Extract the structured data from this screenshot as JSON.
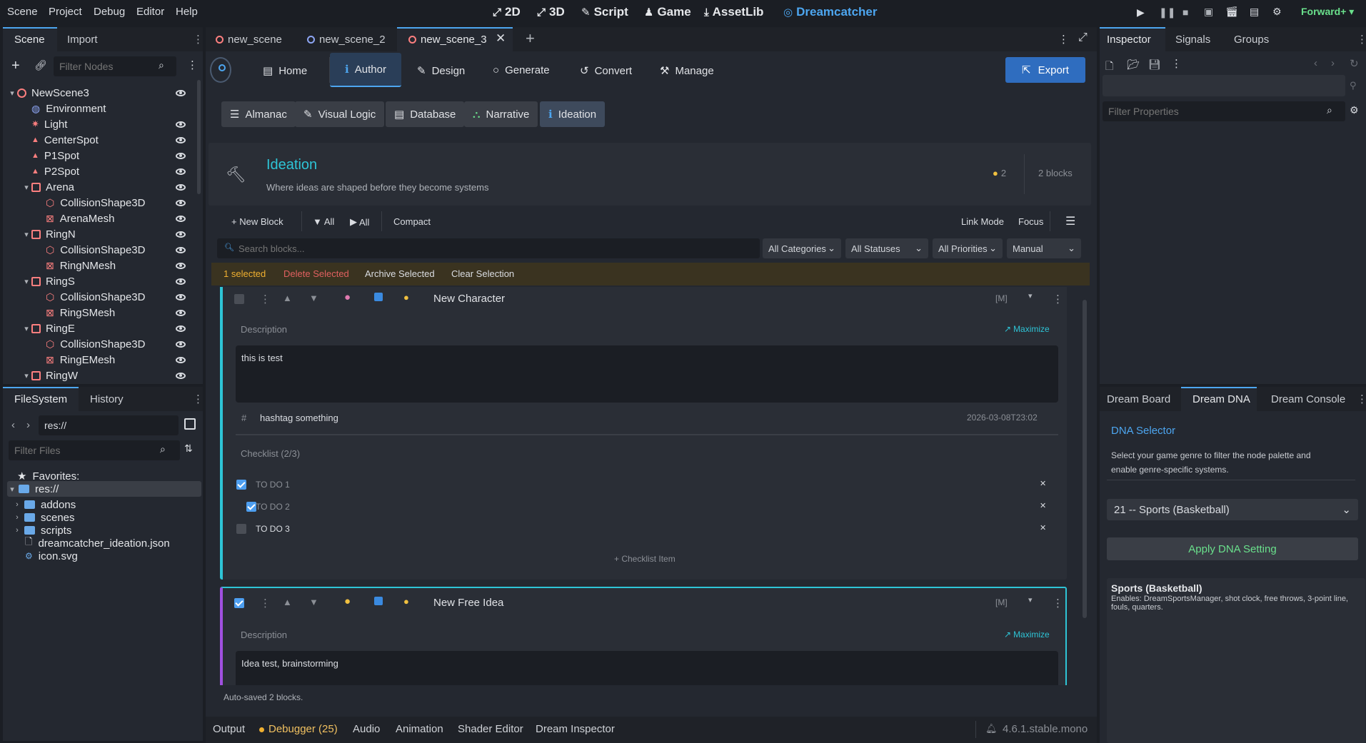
{
  "menubar": {
    "items": [
      "Scene",
      "Project",
      "Debug",
      "Editor",
      "Help"
    ],
    "workspaces": [
      "2D",
      "3D",
      "Script",
      "Game",
      "AssetLib",
      "Dreamcatcher"
    ],
    "renderer": "Forward+"
  },
  "scene_dock": {
    "tabs": [
      "Scene",
      "Import"
    ],
    "filter_placeholder": "Filter Nodes",
    "tree": [
      {
        "name": "NewScene3",
        "depth": 0,
        "icon": "circle",
        "expand": "down"
      },
      {
        "name": "Environment",
        "depth": 1,
        "icon": "env",
        "eye": false
      },
      {
        "name": "Light",
        "depth": 1,
        "icon": "light"
      },
      {
        "name": "CenterSpot",
        "depth": 1,
        "icon": "spot"
      },
      {
        "name": "P1Spot",
        "depth": 1,
        "icon": "spot"
      },
      {
        "name": "P2Spot",
        "depth": 1,
        "icon": "spot"
      },
      {
        "name": "Arena",
        "depth": 1,
        "icon": "node",
        "expand": "down"
      },
      {
        "name": "CollisionShape3D",
        "depth": 2,
        "icon": "col"
      },
      {
        "name": "ArenaMesh",
        "depth": 2,
        "icon": "mesh"
      },
      {
        "name": "RingN",
        "depth": 1,
        "icon": "node",
        "expand": "down"
      },
      {
        "name": "CollisionShape3D",
        "depth": 2,
        "icon": "col"
      },
      {
        "name": "RingNMesh",
        "depth": 2,
        "icon": "mesh"
      },
      {
        "name": "RingS",
        "depth": 1,
        "icon": "node",
        "expand": "down"
      },
      {
        "name": "CollisionShape3D",
        "depth": 2,
        "icon": "col"
      },
      {
        "name": "RingSMesh",
        "depth": 2,
        "icon": "mesh"
      },
      {
        "name": "RingE",
        "depth": 1,
        "icon": "node",
        "expand": "down"
      },
      {
        "name": "CollisionShape3D",
        "depth": 2,
        "icon": "col"
      },
      {
        "name": "RingEMesh",
        "depth": 2,
        "icon": "mesh"
      },
      {
        "name": "RingW",
        "depth": 1,
        "icon": "node",
        "expand": "down"
      }
    ]
  },
  "filesystem": {
    "tabs": [
      "FileSystem",
      "History"
    ],
    "path": "res://",
    "filter_placeholder": "Filter Files",
    "favorites": "Favorites:",
    "root": "res://",
    "items": [
      {
        "name": "addons",
        "type": "folder"
      },
      {
        "name": "scenes",
        "type": "folder"
      },
      {
        "name": "scripts",
        "type": "folder"
      },
      {
        "name": "dreamcatcher_ideation.json",
        "type": "file"
      },
      {
        "name": "icon.svg",
        "type": "svg"
      }
    ]
  },
  "scene_tabs": [
    "new_scene",
    "new_scene_2",
    "new_scene_3"
  ],
  "plugin": {
    "nav": [
      "Home",
      "Author",
      "Design",
      "Generate",
      "Convert",
      "Manage"
    ],
    "export": "Export",
    "subnav": [
      "Almanac",
      "Visual Logic",
      "Database",
      "Narrative",
      "Ideation"
    ],
    "header": {
      "title": "Ideation",
      "subtitle": "Where ideas are shaped before they become systems",
      "ideas": "2",
      "blocks": "2 blocks"
    },
    "toolbar": {
      "new_block": "+ New Block",
      "collapse_all": "All",
      "expand_all": "All",
      "compact": "Compact",
      "link_mode": "Link Mode",
      "focus": "Focus"
    },
    "search_placeholder": "Search blocks...",
    "filters": [
      "All Categories",
      "All Statuses",
      "All Priorities",
      "Manual"
    ],
    "selection": {
      "count": "1 selected",
      "delete": "Delete Selected",
      "archive": "Archive Selected",
      "clear": "Clear Selection"
    },
    "block1": {
      "title": "New Character",
      "tag": "[M]",
      "desc_label": "Description",
      "maximize": "Maximize",
      "desc": "this is test",
      "hashtag": "hashtag something",
      "date": "2026-03-08T23:02",
      "checklist_label": "Checklist (2/3)",
      "items": [
        {
          "text": "TO DO 1",
          "done": true
        },
        {
          "text": "TO DO 2",
          "done": true
        },
        {
          "text": "TO DO 3",
          "done": false
        }
      ],
      "add_item": "+ Checklist Item"
    },
    "block2": {
      "title": "New Free Idea",
      "tag": "[M]",
      "desc_label": "Description",
      "maximize": "Maximize",
      "desc": "Idea test, brainstorming"
    },
    "status": "Auto-saved 2 blocks."
  },
  "inspector": {
    "tabs": [
      "Inspector",
      "Signals",
      "Groups"
    ],
    "filter_placeholder": "Filter Properties"
  },
  "dream": {
    "tabs": [
      "Dream Board",
      "Dream DNA",
      "Dream Console"
    ],
    "title": "DNA Selector",
    "desc": "Select your game genre to filter the node palette and enable genre-specific systems.",
    "selected": "21 -- Sports (Basketball)",
    "apply": "Apply DNA Setting",
    "info_title": "Sports (Basketball)",
    "info_desc": "Enables: DreamSportsManager, shot clock, free throws, 3-point line, fouls, quarters."
  },
  "bottom": {
    "tabs": [
      "Output",
      "Debugger (25)",
      "Audio",
      "Animation",
      "Shader Editor",
      "Dream Inspector"
    ],
    "version": "4.6.1.stable.mono"
  },
  "colors": {
    "accent": "#4da6f0",
    "teal": "#2ec4d6",
    "selected_bar": "#3a3320",
    "delete": "#e06060",
    "green": "#6ae08c"
  }
}
